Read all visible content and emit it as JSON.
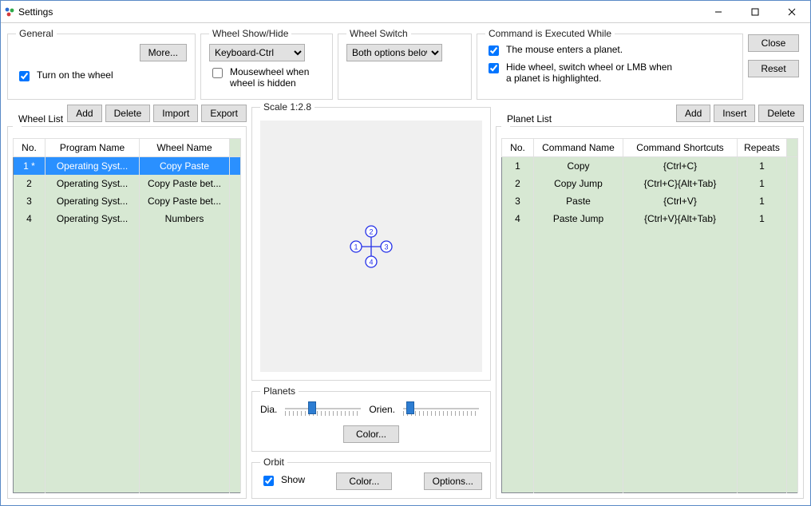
{
  "window": {
    "title": "Settings"
  },
  "titlebar_icons": {
    "min": "—",
    "max": "☐",
    "close": "✕"
  },
  "top": {
    "general": {
      "legend": "General",
      "more": "More...",
      "turn_on": "Turn on the wheel",
      "turn_on_checked": true
    },
    "showhide": {
      "legend": "Wheel Show/Hide",
      "select": "Keyboard-Ctrl",
      "mousewheel": "Mousewheel when wheel is hidden",
      "mousewheel_checked": false
    },
    "switch": {
      "legend": "Wheel Switch",
      "select": "Both options below"
    },
    "exec": {
      "legend": "Command is Executed While",
      "a": "The mouse enters a planet.",
      "a_checked": true,
      "b": "Hide wheel, switch wheel or LMB when a planet is highlighted.",
      "b_checked": true
    },
    "close": "Close",
    "reset": "Reset"
  },
  "wheel_list": {
    "legend": "Wheel List",
    "buttons": {
      "add": "Add",
      "delete": "Delete",
      "import": "Import",
      "export": "Export"
    },
    "cols": {
      "no": "No.",
      "program": "Program Name",
      "wheel": "Wheel Name"
    },
    "rows": [
      {
        "no": "1 *",
        "program": "Operating Syst...",
        "wheel": "Copy Paste",
        "selected": true
      },
      {
        "no": "2",
        "program": "Operating Syst...",
        "wheel": "Copy Paste bet..."
      },
      {
        "no": "3",
        "program": "Operating Syst...",
        "wheel": "Copy Paste bet..."
      },
      {
        "no": "4",
        "program": "Operating Syst...",
        "wheel": "Numbers"
      }
    ]
  },
  "scale": {
    "legend": "Scale 1:2.8"
  },
  "planets_group": {
    "legend": "Planets",
    "dia": "Dia.",
    "orien": "Orien.",
    "color": "Color..."
  },
  "orbit": {
    "legend": "Orbit",
    "show": "Show",
    "show_checked": true,
    "color": "Color...",
    "options": "Options..."
  },
  "planet_list": {
    "legend": "Planet List",
    "buttons": {
      "add": "Add",
      "insert": "Insert",
      "delete": "Delete"
    },
    "cols": {
      "no": "No.",
      "cmd": "Command Name",
      "sc": "Command Shortcuts",
      "rep": "Repeats"
    },
    "rows": [
      {
        "no": "1",
        "cmd": "Copy",
        "sc": "{Ctrl+C}",
        "rep": "1"
      },
      {
        "no": "2",
        "cmd": "Copy Jump",
        "sc": "{Ctrl+C}{Alt+Tab}",
        "rep": "1"
      },
      {
        "no": "3",
        "cmd": "Paste",
        "sc": "{Ctrl+V}",
        "rep": "1"
      },
      {
        "no": "4",
        "cmd": "Paste Jump",
        "sc": "{Ctrl+V}{Alt+Tab}",
        "rep": "1"
      }
    ]
  },
  "colors": {
    "accent": "#2d7dd2",
    "grid_row": "#d7e8d3"
  }
}
